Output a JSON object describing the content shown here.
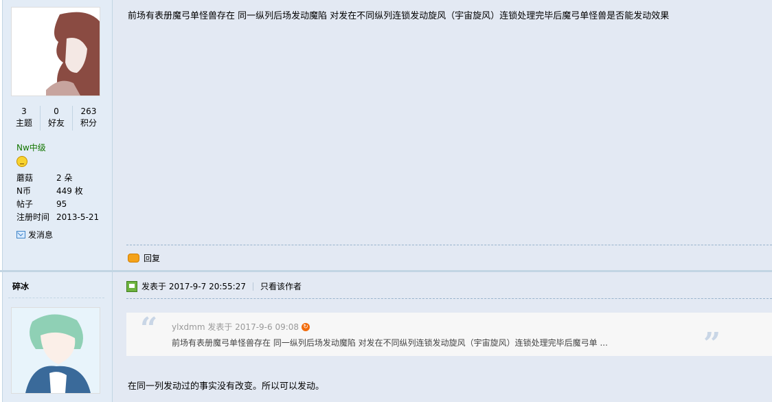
{
  "user1": {
    "stats": [
      {
        "value": "3",
        "label": "主题"
      },
      {
        "value": "0",
        "label": "好友"
      },
      {
        "value": "263",
        "label": "积分"
      }
    ],
    "level": "Nw中级",
    "info": [
      {
        "key": "蘑菇",
        "value": "2 朵"
      },
      {
        "key": "N币",
        "value": "449 枚"
      },
      {
        "key": "帖子",
        "value": "95"
      },
      {
        "key": "注册时间",
        "value": "2013-5-21"
      }
    ],
    "send_message": "发消息"
  },
  "post1": {
    "content": "前场有表册魔弓单怪兽存在 同一纵列后场发动魔陷 对发在不同纵列连锁发动旋风（宇宙旋风）连锁处理完毕后魔弓单怪兽是否能发动效果",
    "reply_label": "回复"
  },
  "user2": {
    "name": "碎冰"
  },
  "post2": {
    "posted_at": "发表于 2017-9-7 20:55:27",
    "only_author": "只看该作者",
    "quote": {
      "author_line": "ylxdmm 发表于 2017-9-6 09:08",
      "text": "前场有表册魔弓单怪兽存在 同一纵列后场发动魔陷 对发在不同纵列连锁发动旋风（宇宙旋风）连锁处理完毕后魔弓单 ..."
    },
    "content": "在同一列发动过的事实没有改变。所以可以发动。"
  },
  "icons": {
    "online": "online-status-icon",
    "reply": "reply-bubble-icon",
    "message": "envelope-icon",
    "quote_link": "goto-arrow-icon"
  }
}
